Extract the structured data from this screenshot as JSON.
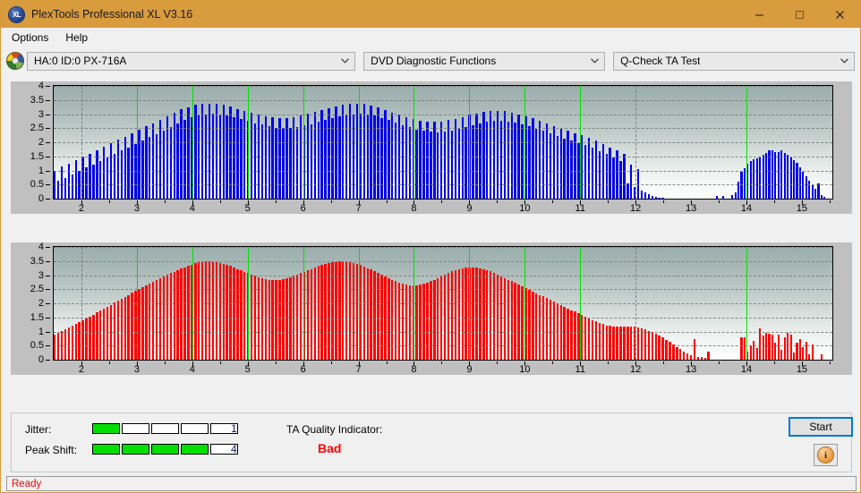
{
  "window": {
    "title": "PlexTools Professional XL V3.16",
    "icon": "xl-app-icon",
    "icon_label": "XL",
    "minimize": "minimize-icon",
    "maximize": "maximize-icon",
    "close": "close-icon",
    "titlebar_color": "#d89b3e"
  },
  "menu": {
    "items": [
      {
        "label": "Options"
      },
      {
        "label": "Help"
      }
    ]
  },
  "toolbar": {
    "drive_icon": "disc-icon",
    "drive": "HA:0 ID:0  PX-716A",
    "function": "DVD Diagnostic Functions",
    "test": "Q-Check TA Test",
    "chevron": "chevron-down-icon"
  },
  "bottom": {
    "jitter_label": "Jitter:",
    "jitter_value": "1",
    "jitter_filled": 1,
    "jitter_cells": 5,
    "peak_shift_label": "Peak Shift:",
    "peak_shift_value": "4",
    "peak_shift_filled": 4,
    "peak_shift_cells": 5,
    "ta_label": "TA Quality Indicator:",
    "ta_value": "Bad",
    "ta_color": "#ff0000",
    "start_label": "Start",
    "info_label": "i",
    "meter_on_color": "#00e000"
  },
  "status": {
    "text": "Ready",
    "color": "#ff0000"
  },
  "chart_data": [
    {
      "id": "ta-test-pit-lengths",
      "type": "bar",
      "title": "",
      "xlabel": "",
      "ylabel": "",
      "color": "#0000e6",
      "marker_color": "#00e000",
      "grid": true,
      "xlim": [
        1.5,
        15.55
      ],
      "ylim": [
        0,
        4
      ],
      "xticks": [
        2,
        3,
        4,
        5,
        6,
        7,
        8,
        9,
        10,
        11,
        12,
        13,
        14,
        15
      ],
      "yticks": [
        0,
        0.5,
        1,
        1.5,
        2,
        2.5,
        3,
        3.5,
        4
      ],
      "ytick_labels": [
        "0",
        "0.5",
        "1",
        "1.5",
        "2",
        "2.5",
        "3",
        "3.5",
        "4"
      ],
      "markers_x": [
        3.0,
        4.0,
        5.0,
        6.0,
        7.0,
        8.0,
        9.0,
        10.0,
        11.0,
        14.0
      ],
      "n_bars": 190,
      "values": [
        1.0,
        0.62,
        1.13,
        0.74,
        1.25,
        0.86,
        1.37,
        0.98,
        1.49,
        1.1,
        1.6,
        1.22,
        1.72,
        1.34,
        1.84,
        1.46,
        1.96,
        1.58,
        2.08,
        1.7,
        2.2,
        1.82,
        2.32,
        1.94,
        2.45,
        2.07,
        2.57,
        2.19,
        2.68,
        2.3,
        2.8,
        2.42,
        2.92,
        2.54,
        3.04,
        2.66,
        3.16,
        2.78,
        3.25,
        2.88,
        3.32,
        2.95,
        3.36,
        2.99,
        3.38,
        3.01,
        3.36,
        2.99,
        3.32,
        2.95,
        3.26,
        2.89,
        3.19,
        2.82,
        3.12,
        2.75,
        3.05,
        2.68,
        2.98,
        2.62,
        2.92,
        2.56,
        2.88,
        2.52,
        2.86,
        2.5,
        2.87,
        2.51,
        2.9,
        2.54,
        2.95,
        2.59,
        3.01,
        2.65,
        3.08,
        2.72,
        3.15,
        2.79,
        3.22,
        2.86,
        3.28,
        2.92,
        3.33,
        2.97,
        3.36,
        3.0,
        3.37,
        3.01,
        3.35,
        2.99,
        3.3,
        2.94,
        3.23,
        2.87,
        3.15,
        2.79,
        3.06,
        2.7,
        2.97,
        2.61,
        2.89,
        2.53,
        2.82,
        2.46,
        2.76,
        2.4,
        2.73,
        2.37,
        2.72,
        2.36,
        2.74,
        2.38,
        2.78,
        2.42,
        2.84,
        2.48,
        2.9,
        2.54,
        2.97,
        2.61,
        3.03,
        2.67,
        3.08,
        2.72,
        3.11,
        2.75,
        3.12,
        2.76,
        3.1,
        2.74,
        3.06,
        2.7,
        3.0,
        2.64,
        2.93,
        2.57,
        2.85,
        2.49,
        2.76,
        2.4,
        2.67,
        2.31,
        2.58,
        2.22,
        2.49,
        2.13,
        2.41,
        2.05,
        2.33,
        1.97,
        2.25,
        1.89,
        2.16,
        1.8,
        2.05,
        1.69,
        1.94,
        1.58,
        1.82,
        1.46,
        1.7,
        1.34,
        1.58,
        0.55,
        1.2,
        0.42,
        1.06,
        0.3,
        0.22,
        0.16,
        0.1,
        0.06,
        0.04,
        0.02,
        0,
        0,
        0,
        0,
        0,
        0,
        0,
        0,
        0,
        0,
        0,
        0,
        0,
        0,
        0,
        0
      ],
      "tail_values": [
        0.08,
        0,
        0.08,
        0,
        0,
        0.12,
        0.22,
        0.6,
        0.95,
        1.08,
        1.25,
        1.32,
        1.4,
        1.44,
        1.5,
        1.56,
        1.62,
        1.7,
        1.72,
        1.66,
        1.64,
        1.7,
        1.62,
        1.55,
        1.47,
        1.38,
        1.26,
        1.12,
        0.96,
        0.8,
        0.64,
        0.48,
        0.34,
        0.55,
        0.12,
        0.05
      ]
    },
    {
      "id": "ta-test-land-lengths",
      "type": "bar",
      "title": "",
      "xlabel": "",
      "ylabel": "",
      "color": "#fc0000",
      "marker_color": "#00e000",
      "grid": true,
      "xlim": [
        1.5,
        15.55
      ],
      "ylim": [
        0,
        4
      ],
      "xticks": [
        2,
        3,
        4,
        5,
        6,
        7,
        8,
        9,
        10,
        11,
        12,
        13,
        14,
        15
      ],
      "yticks": [
        0,
        0.5,
        1,
        1.5,
        2,
        2.5,
        3,
        3.5,
        4
      ],
      "ytick_labels": [
        "0",
        "0.5",
        "1",
        "1.5",
        "2",
        "2.5",
        "3",
        "3.5",
        "4"
      ],
      "markers_x": [
        3.0,
        4.0,
        5.0,
        6.0,
        7.0,
        8.0,
        9.0,
        10.0,
        11.0,
        14.0
      ],
      "n_bars": 190,
      "values": [
        0.9,
        0.96,
        1.02,
        1.08,
        1.14,
        1.2,
        1.27,
        1.33,
        1.4,
        1.46,
        1.53,
        1.6,
        1.67,
        1.74,
        1.81,
        1.88,
        1.95,
        2.02,
        2.09,
        2.16,
        2.23,
        2.3,
        2.37,
        2.44,
        2.51,
        2.57,
        2.64,
        2.7,
        2.77,
        2.83,
        2.89,
        2.95,
        3.01,
        3.07,
        3.12,
        3.18,
        3.23,
        3.28,
        3.33,
        3.38,
        3.42,
        3.45,
        3.47,
        3.48,
        3.48,
        3.47,
        3.45,
        3.43,
        3.4,
        3.36,
        3.32,
        3.27,
        3.22,
        3.17,
        3.12,
        3.07,
        3.02,
        2.97,
        2.93,
        2.89,
        2.86,
        2.84,
        2.83,
        2.83,
        2.84,
        2.86,
        2.89,
        2.93,
        2.97,
        3.02,
        3.07,
        3.12,
        3.17,
        3.22,
        3.27,
        3.32,
        3.36,
        3.4,
        3.43,
        3.45,
        3.47,
        3.48,
        3.48,
        3.47,
        3.45,
        3.42,
        3.39,
        3.35,
        3.3,
        3.25,
        3.2,
        3.14,
        3.08,
        3.02,
        2.96,
        2.9,
        2.84,
        2.79,
        2.74,
        2.7,
        2.67,
        2.65,
        2.64,
        2.64,
        2.66,
        2.69,
        2.73,
        2.78,
        2.84,
        2.9,
        2.96,
        3.02,
        3.08,
        3.13,
        3.18,
        3.22,
        3.25,
        3.27,
        3.28,
        3.28,
        3.27,
        3.25,
        3.22,
        3.18,
        3.13,
        3.08,
        3.02,
        2.96,
        2.9,
        2.84,
        2.78,
        2.72,
        2.66,
        2.6,
        2.54,
        2.48,
        2.42,
        2.36,
        2.3,
        2.24,
        2.18,
        2.12,
        2.06,
        2.0,
        1.94,
        1.88,
        1.82,
        1.76,
        1.7,
        1.64,
        1.58,
        1.52,
        1.46,
        1.4,
        1.35,
        1.3,
        1.26,
        1.22,
        1.2,
        1.18,
        1.17,
        1.16,
        1.16,
        1.17,
        1.18,
        1.17,
        1.15,
        1.12,
        1.08,
        1.03,
        0.98,
        0.92,
        0.85,
        0.78,
        0.7,
        0.62,
        0.54,
        0.46,
        0.38,
        0.3,
        0.22,
        0.16,
        0.72,
        0.11,
        0.08,
        0.06,
        0.28,
        0,
        0,
        0
      ],
      "tail_values": [
        0,
        0,
        0,
        0,
        0,
        0,
        0,
        0,
        0.78,
        0.8,
        0.3,
        0.52,
        0.68,
        0.42,
        1.12,
        0.85,
        0.95,
        0.92,
        0.88,
        0.6,
        0.9,
        0.35,
        0.78,
        0.95,
        0.9,
        0.25,
        0.6,
        0.72,
        0.45,
        0.62,
        0.2,
        0.55,
        0,
        0,
        0.18,
        0
      ]
    }
  ]
}
